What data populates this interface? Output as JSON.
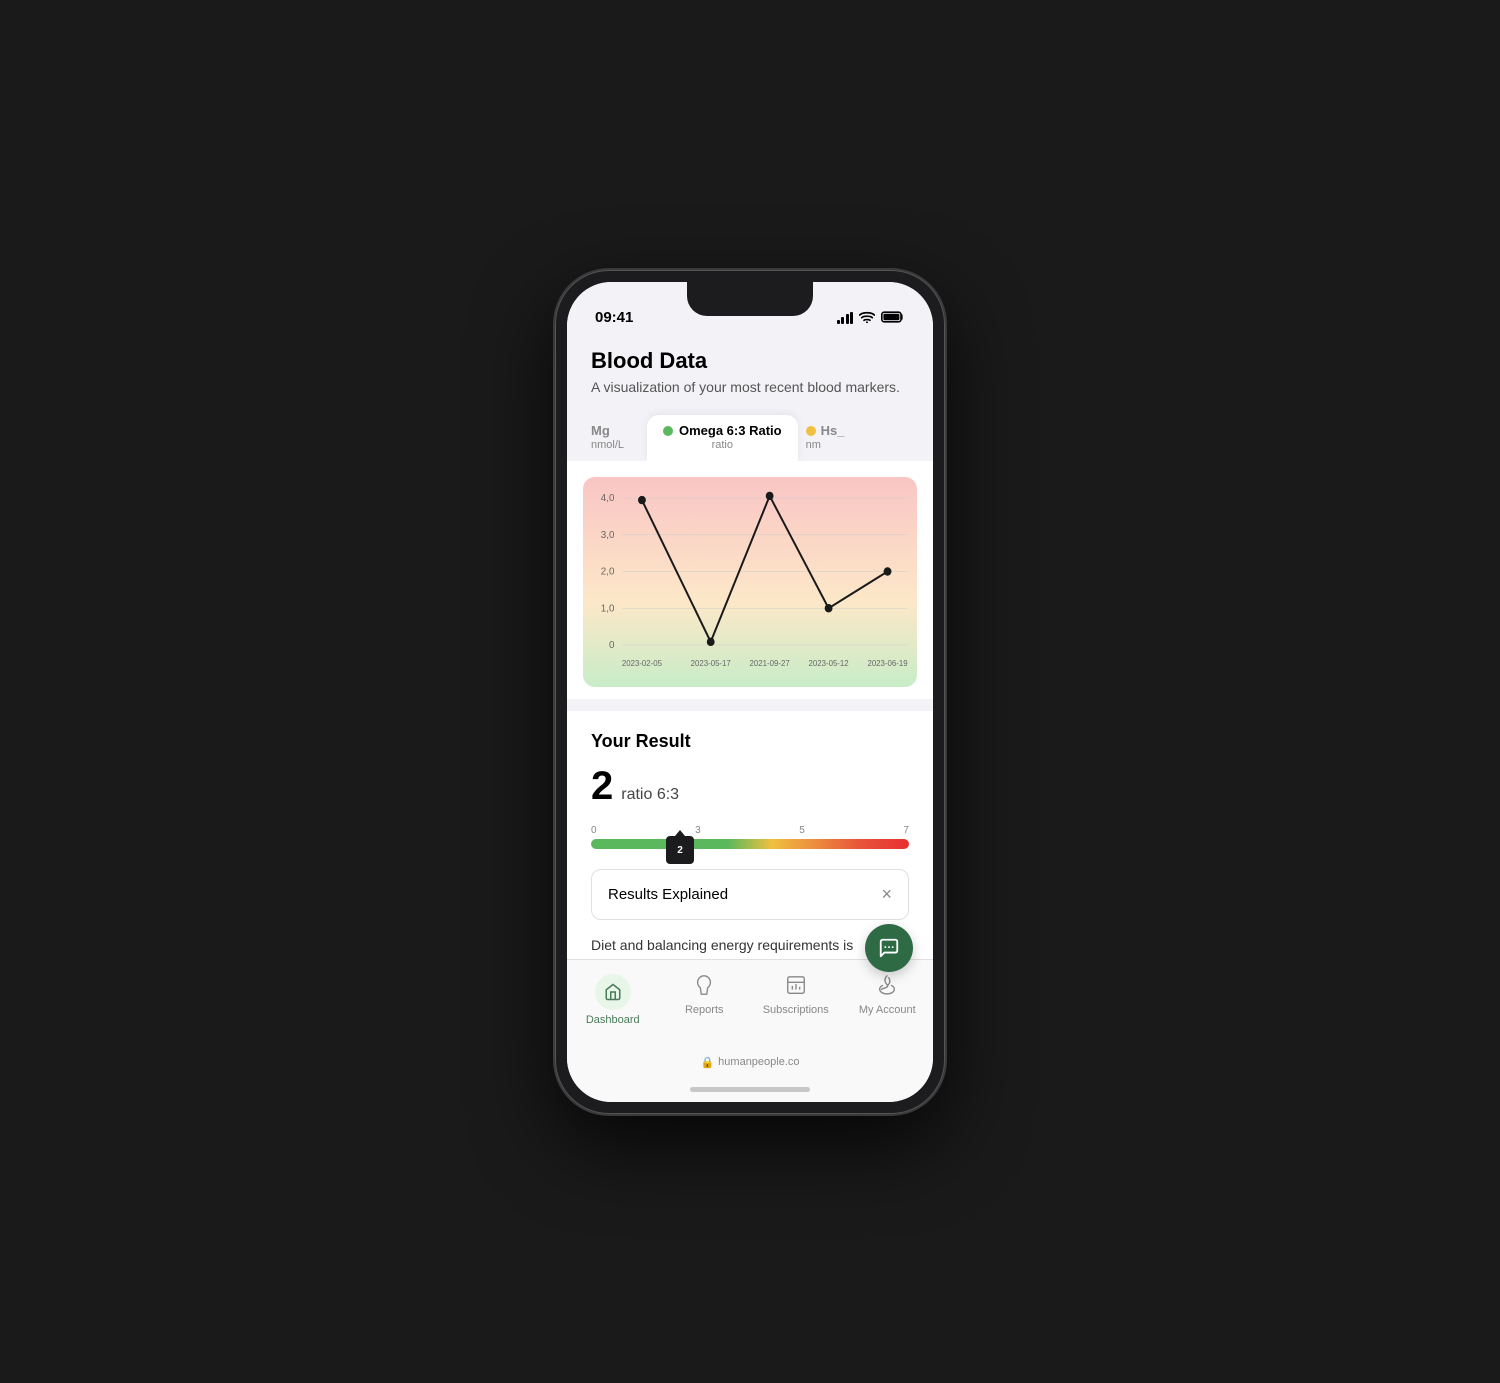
{
  "phone": {
    "status_time": "09:41"
  },
  "header": {
    "title": "Blood Data",
    "subtitle": "A visualization of your most recent blood markers."
  },
  "tabs": [
    {
      "id": "mg",
      "label": "Mg",
      "unit": "nmol/L",
      "dot_color": null,
      "active": false,
      "partial": "left"
    },
    {
      "id": "omega",
      "label": "Omega 6:3 Ratio",
      "unit": "ratio",
      "dot_color": "#5cb85c",
      "active": true,
      "partial": false
    },
    {
      "id": "hs",
      "label": "Hs_",
      "unit": "nm",
      "dot_color": "#f0c040",
      "active": false,
      "partial": "right"
    }
  ],
  "chart": {
    "x_labels": [
      "2023-02-05",
      "2023-05-17",
      "2021-09-27",
      "2023-05-12",
      "2023-06-19"
    ],
    "y_labels": [
      "4,0",
      "3,0",
      "2,0",
      "1,0",
      "0"
    ],
    "data_points": [
      {
        "x": 0,
        "y": 4.0
      },
      {
        "x": 1,
        "y": 0.1
      },
      {
        "x": 2,
        "y": 4.2
      },
      {
        "x": 3,
        "y": 1.0
      },
      {
        "x": 4,
        "y": 2.0
      }
    ]
  },
  "result": {
    "section_title": "Your Result",
    "value": "2",
    "unit": "ratio 6:3",
    "slider": {
      "min": 0,
      "max": 7,
      "markers": [
        "0",
        "3",
        "5",
        "7"
      ],
      "current": 2,
      "thumb_label": "2"
    }
  },
  "results_explained": {
    "label": "Results Explained",
    "close_symbol": "×"
  },
  "diet_text": "Diet and balancing energy requirements is essential for fitness. If e burning lots of calories as well",
  "nav": {
    "items": [
      {
        "id": "dashboard",
        "label": "Dashboard",
        "icon": "🏠",
        "active": true
      },
      {
        "id": "reports",
        "label": "Reports",
        "icon": "💧",
        "active": false
      },
      {
        "id": "subscriptions",
        "label": "Subscriptions",
        "icon": "📊",
        "active": false
      },
      {
        "id": "account",
        "label": "My Account",
        "icon": "❤️",
        "active": false
      }
    ]
  },
  "footer": {
    "lock_icon": "🔒",
    "text": "humanpeople.co"
  },
  "colors": {
    "accent_green": "#4a7c59",
    "chart_bg_top": "#fce4e4",
    "chart_bg_bottom": "#e8f5e9",
    "gradient_green": "#5cb85c",
    "gradient_yellow": "#f0c040",
    "gradient_red": "#e83030"
  }
}
